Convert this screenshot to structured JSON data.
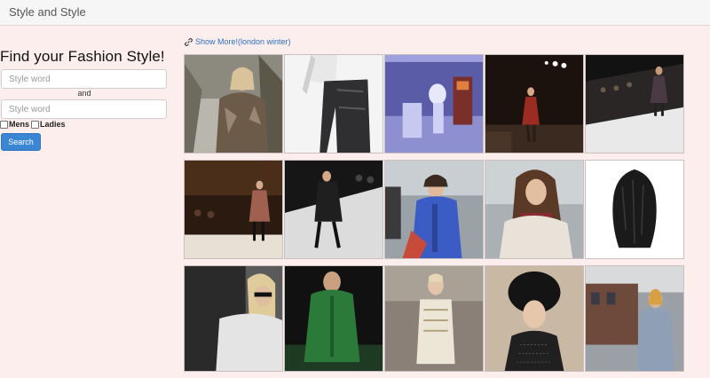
{
  "navbar": {
    "brand": "Style and Style"
  },
  "form": {
    "heading": "Find your Fashion Style!",
    "word1_placeholder": "Style word",
    "and_label": "and",
    "word2_placeholder": "Style word",
    "mens_label": "Mens",
    "ladies_label": "Ladies",
    "search_label": "Search"
  },
  "results": {
    "more_link": "Show More!(london winter)"
  },
  "colors": {
    "background": "#fdeeee",
    "accent": "#3a86d4",
    "link": "#2a6fbf"
  }
}
